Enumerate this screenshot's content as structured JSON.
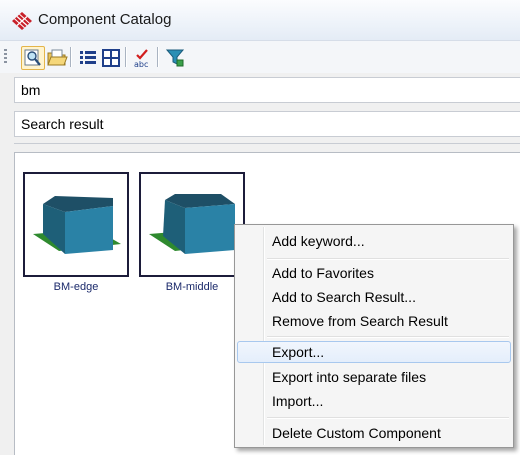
{
  "window": {
    "title": "Component Catalog",
    "icon": "grid-app-icon"
  },
  "toolbar": {
    "buttons": [
      {
        "name": "search-catalog-icon",
        "active": true
      },
      {
        "name": "open-folder-icon",
        "active": false
      },
      {
        "name": "list-view-icon",
        "active": false
      },
      {
        "name": "tile-view-icon",
        "active": false
      },
      {
        "name": "spellcheck-abc-icon",
        "active": false
      },
      {
        "name": "filter-export-icon",
        "active": false
      }
    ]
  },
  "search": {
    "value": "bm"
  },
  "result_header": {
    "label": "Search result"
  },
  "results": {
    "items": [
      {
        "label": "BM-edge"
      },
      {
        "label": "BM-middle"
      }
    ]
  },
  "context_menu": {
    "items": [
      {
        "label": "Add keyword..."
      },
      {
        "label": "Add to Favorites"
      },
      {
        "label": "Add to Search Result..."
      },
      {
        "label": "Remove from Search Result"
      },
      {
        "label": "Export...",
        "highlighted": true
      },
      {
        "label": "Export into separate files"
      },
      {
        "label": "Import..."
      },
      {
        "label": "Delete Custom Component"
      }
    ]
  },
  "colors": {
    "block_top": "#1e4f66",
    "block_front": "#2a82a6",
    "base_plate": "#2f8a2f",
    "tile_border": "#1c1c3a",
    "menu_highlight_border": "#a8c8ee"
  }
}
